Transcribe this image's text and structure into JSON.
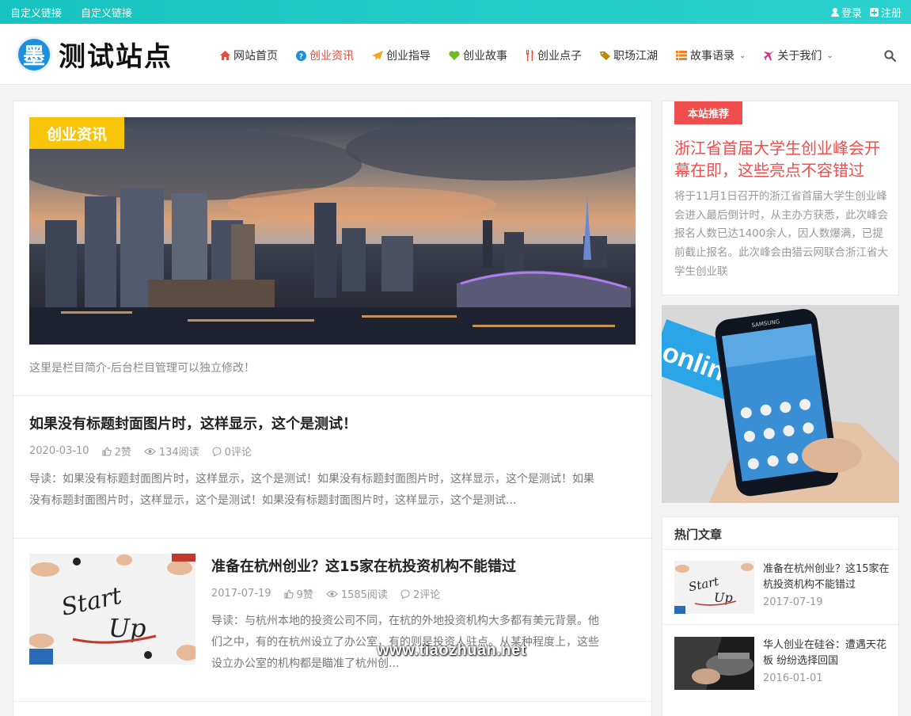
{
  "topbar": {
    "links": [
      "自定义链接",
      "自定义链接"
    ],
    "login": "登录",
    "register": "注册"
  },
  "header": {
    "logo_char": "墨",
    "site_name": "测试站点",
    "nav": [
      {
        "label": "网站首页",
        "icon": "home-icon",
        "color": "#e74c3c"
      },
      {
        "label": "创业资讯",
        "icon": "question-circle-icon",
        "color": "#1e8fdc",
        "active": true
      },
      {
        "label": "创业指导",
        "icon": "paper-plane-icon",
        "color": "#f5a623"
      },
      {
        "label": "创业故事",
        "icon": "heart-icon",
        "color": "#6fba2c"
      },
      {
        "label": "创业点子",
        "icon": "cutlery-icon",
        "color": "#e74c3c"
      },
      {
        "label": "职场江湖",
        "icon": "tag-icon",
        "color": "#b8860b"
      },
      {
        "label": "故事语录",
        "icon": "list-icon",
        "color": "#f07f1d",
        "dropdown": true
      },
      {
        "label": "关于我们",
        "icon": "plane-icon",
        "color": "#d6338a",
        "dropdown": true
      }
    ]
  },
  "main": {
    "category_tag": "创业资讯",
    "intro": "这里是栏目简介-后台栏目管理可以独立修改！",
    "posts": [
      {
        "title": "如果没有标题封面图片时，这样显示，这个是测试！",
        "date": "2020-03-10",
        "likes": "2赞",
        "views": "134阅读",
        "comments": "0评论",
        "excerpt_line1": "导读：如果没有标题封面图片时，这样显示，这个是测试！如果没有标题封面图片时，这样显示，这个是测试！如果",
        "excerpt_line2": "没有标题封面图片时，这样显示，这个是测试！如果没有标题封面图片时，这样显示，这个是测试..."
      },
      {
        "title": "准备在杭州创业？这15家在杭投资机构不能错过",
        "date": "2017-07-19",
        "likes": "9赞",
        "views": "1585阅读",
        "comments": "2评论",
        "thumb_text_1": "Start",
        "thumb_text_2": "Up",
        "excerpt_line1": "导读：与杭州本地的投资公司不同，在杭的外地投资机构大多都有美元背景。他",
        "excerpt_line2": "们之中，有的在杭州设立了办公室，有的则是投资人驻点。从某种程度上，这些",
        "excerpt_line3": "设立办公室的机构都是瞄准了杭州创..."
      }
    ]
  },
  "sidebar": {
    "recommend_tag": "本站推荐",
    "recommend_title": "浙江省首届大学生创业峰会开幕在即，这些亮点不容错过",
    "recommend_excerpt": "将于11月1日召开的浙江省首届大学生创业峰会进入最后倒计时，从主办方获悉，此次峰会报名人数已达1400余人，因人数爆满，已提前截止报名。此次峰会由猎云网联合浙江省大学生创业联",
    "ad_brand": "SAMSUNG",
    "ad_banner_text": "onlin",
    "hot_heading": "热门文章",
    "hot_items": [
      {
        "title": "准备在杭州创业？这15家在杭投资机构不能错过",
        "date": "2017-07-19"
      },
      {
        "title": "华人创业在硅谷：遭遇天花板 纷纷选择回国",
        "date": "2016-01-01"
      }
    ]
  },
  "watermark": "www.tiaozhuan.net"
}
